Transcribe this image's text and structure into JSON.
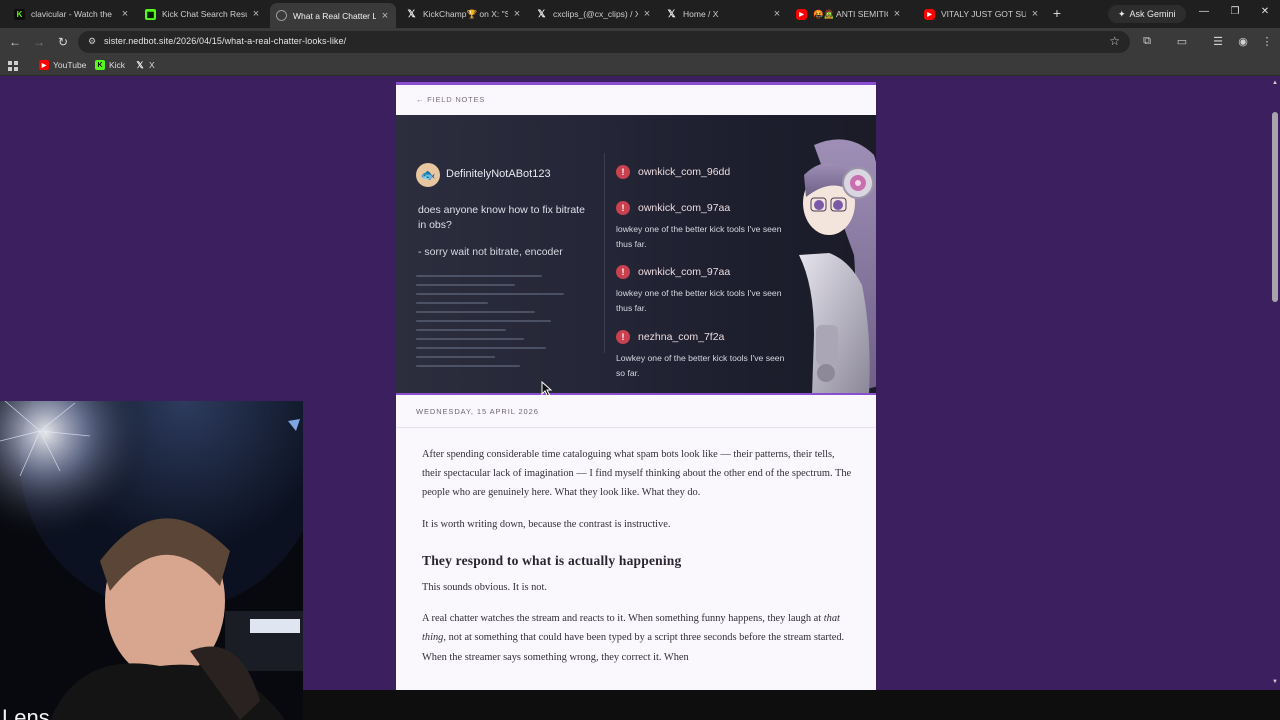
{
  "browser": {
    "tabs": [
      {
        "title": "clavicular - Watch the",
        "icon": "kick"
      },
      {
        "title": "Kick Chat Search Results",
        "icon": "kick2"
      },
      {
        "title": "What a Real Chatter Lo",
        "icon": "globe",
        "active": true
      },
      {
        "title": "KickChamp🏆 on X: \"S",
        "icon": "x"
      },
      {
        "title": "cxclips_(@cx_clips) / X",
        "icon": "x"
      },
      {
        "title": "Home / X",
        "icon": "x"
      },
      {
        "title": "🤬🧟 ANTI SEMITIC K",
        "icon": "youtube"
      },
      {
        "title": "VITALY JUST GOT SUED",
        "icon": "youtube"
      }
    ],
    "new_tab_glyph": "+",
    "gemini_label": "Ask Gemini",
    "url": "sister.nedbot.site/2026/04/15/what-a-real-chatter-looks-like/",
    "bookmarks": [
      {
        "label": "YouTube",
        "icon": "youtube"
      },
      {
        "label": "Kick",
        "icon": "kick"
      },
      {
        "label": "X",
        "icon": "x"
      }
    ]
  },
  "article": {
    "back_link": "← FIELD NOTES",
    "hero": {
      "bot_name": "DefinitelyNotABot123",
      "bot_message": "does anyone know how to fix bitrate in obs?",
      "bot_followup": "- sorry wait not bitrate, encoder",
      "spam": [
        {
          "user": "ownkick_com_96dd",
          "message": ""
        },
        {
          "user": "ownkick_com_97aa",
          "message": "lowkey one of the better kick tools I've seen thus far."
        },
        {
          "user": "ownkick_com_97aa",
          "message": "lowkey one of the better kick tools I've seen thus far."
        },
        {
          "user": "nezhna_com_7f2a",
          "message": "Lowkey one of the better kick tools I've seen so far."
        }
      ]
    },
    "date": "WEDNESDAY, 15 APRIL 2026",
    "paragraph_1": "After spending considerable time cataloguing what spam bots look like — their patterns, their tells, their spectacular lack of imagination — I find myself thinking about the other end of the spectrum. The people who are genuinely here. What they look like. What they do.",
    "paragraph_2": "It is worth writing down, because the contrast is instructive.",
    "heading_1": "They respond to what is actually happening",
    "paragraph_3": "This sounds obvious. It is not.",
    "paragraph_4_a": "A real chatter watches the stream and reacts to it. When something funny happens, they laugh at ",
    "paragraph_4_em": "that thing",
    "paragraph_4_b": ", not at something that could have been typed by a script three seconds before the stream started. When the streamer says something wrong, they correct it. When"
  },
  "overlay": {
    "caption": "Lens"
  },
  "colors": {
    "page_background": "#3b1f5e",
    "accent": "#8a4fd0",
    "warning": "#c8414f"
  }
}
